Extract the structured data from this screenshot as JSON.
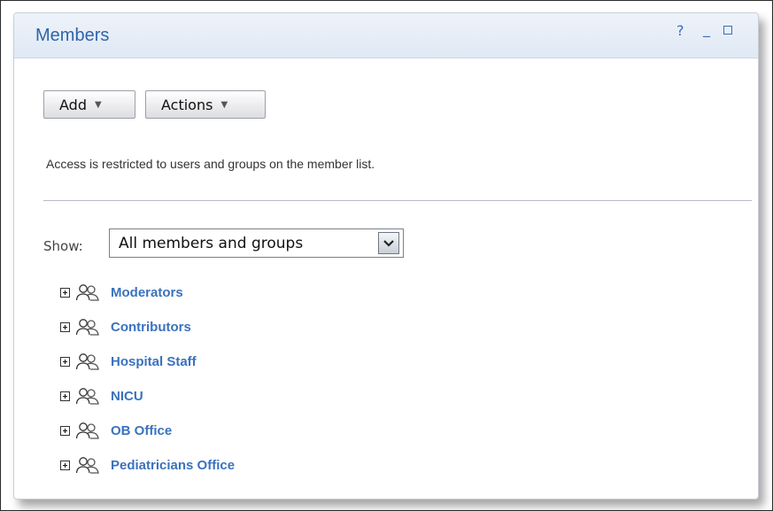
{
  "panel": {
    "title": "Members",
    "help_label": "?",
    "minimize_label": "_"
  },
  "toolbar": {
    "add_label": "Add",
    "actions_label": "Actions"
  },
  "notice": "Access is restricted to users and groups on the member list.",
  "filter": {
    "label": "Show:",
    "selected": "All members and groups"
  },
  "groups": [
    {
      "name": "Moderators"
    },
    {
      "name": "Contributors"
    },
    {
      "name": "Hospital Staff"
    },
    {
      "name": "NICU"
    },
    {
      "name": "OB Office"
    },
    {
      "name": "Pediatricians Office"
    }
  ],
  "colors": {
    "link": "#3a72bd",
    "title": "#2f64a8"
  },
  "icons": {
    "expand": "plus-box-icon",
    "group": "people-group-icon",
    "dropdown": "chevron-down-icon"
  }
}
